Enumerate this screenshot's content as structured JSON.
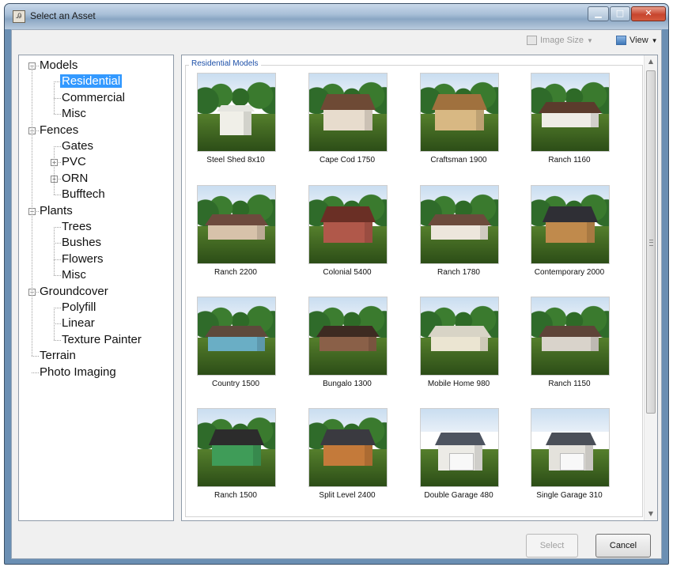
{
  "window": {
    "title": "Select an Asset",
    "app_icon_glyph": "Ꭿ"
  },
  "toolbar": {
    "image_size_label": "Image Size",
    "view_label": "View"
  },
  "tree": {
    "items": [
      {
        "label": "Models",
        "level": 0,
        "expander": "−"
      },
      {
        "label": "Residential",
        "level": 1,
        "selected": true
      },
      {
        "label": "Commercial",
        "level": 1
      },
      {
        "label": "Misc",
        "level": 1
      },
      {
        "label": "Fences",
        "level": 0,
        "expander": "−"
      },
      {
        "label": "Gates",
        "level": 1
      },
      {
        "label": "PVC",
        "level": 1,
        "expander": "+"
      },
      {
        "label": "ORN",
        "level": 1,
        "expander": "+"
      },
      {
        "label": "Bufftech",
        "level": 1
      },
      {
        "label": "Plants",
        "level": 0,
        "expander": "−"
      },
      {
        "label": "Trees",
        "level": 1
      },
      {
        "label": "Bushes",
        "level": 1
      },
      {
        "label": "Flowers",
        "level": 1
      },
      {
        "label": "Misc",
        "level": 1
      },
      {
        "label": "Groundcover",
        "level": 0,
        "expander": "−"
      },
      {
        "label": "Polyfill",
        "level": 1
      },
      {
        "label": "Linear",
        "level": 1
      },
      {
        "label": "Texture Painter",
        "level": 1
      },
      {
        "label": "Terrain",
        "level": 0
      },
      {
        "label": "Photo Imaging",
        "level": 0
      }
    ]
  },
  "assets": {
    "group_label": "Residential Models",
    "items": [
      {
        "caption": "Steel Shed 8x10",
        "roof": "#e6e6e0",
        "wall": "#f0efe8",
        "style": "shed"
      },
      {
        "caption": "Cape Cod 1750",
        "roof": "#6e4a35",
        "wall": "#e7dccd",
        "style": "house"
      },
      {
        "caption": "Craftsman 1900",
        "roof": "#a0713e",
        "wall": "#d8b883",
        "style": "house"
      },
      {
        "caption": "Ranch 1160",
        "roof": "#5b3b2c",
        "wall": "#efece6",
        "style": "ranch"
      },
      {
        "caption": "Ranch 2200",
        "roof": "#6d4a3d",
        "wall": "#d7c2aa",
        "style": "ranch"
      },
      {
        "caption": "Colonial 5400",
        "roof": "#6a2f25",
        "wall": "#b0584a",
        "style": "house"
      },
      {
        "caption": "Ranch 1780",
        "roof": "#6b4b3c",
        "wall": "#ece6dc",
        "style": "ranch"
      },
      {
        "caption": "Contemporary 2000",
        "roof": "#2f2f35",
        "wall": "#c08a4c",
        "style": "house"
      },
      {
        "caption": "Country 1500",
        "roof": "#5e4a3c",
        "wall": "#6aaec5",
        "style": "ranch"
      },
      {
        "caption": "Bungalo 1300",
        "roof": "#3d2b22",
        "wall": "#8a6048",
        "style": "ranch"
      },
      {
        "caption": "Mobile Home 980",
        "roof": "#d8d4c6",
        "wall": "#ebe5d2",
        "style": "ranch"
      },
      {
        "caption": "Ranch 1150",
        "roof": "#5e4438",
        "wall": "#d9d3cb",
        "style": "ranch"
      },
      {
        "caption": "Ranch 1500",
        "roof": "#2c2c2c",
        "wall": "#3f9c58",
        "style": "house"
      },
      {
        "caption": "Split Level 2400",
        "roof": "#3a3a40",
        "wall": "#c47a3a",
        "style": "house"
      },
      {
        "caption": "Double Garage 480",
        "roof": "#4d5460",
        "wall": "#ecebe6",
        "style": "garage"
      },
      {
        "caption": "Single Garage 310",
        "roof": "#4a4f58",
        "wall": "#e4e2dc",
        "style": "garage"
      }
    ]
  },
  "scrollbar": {
    "up": "▲",
    "down": "▼"
  },
  "buttons": {
    "select_label": "Select",
    "cancel_label": "Cancel"
  },
  "colors": {
    "selection": "#3399ff",
    "group_label": "#1c4fa8"
  }
}
